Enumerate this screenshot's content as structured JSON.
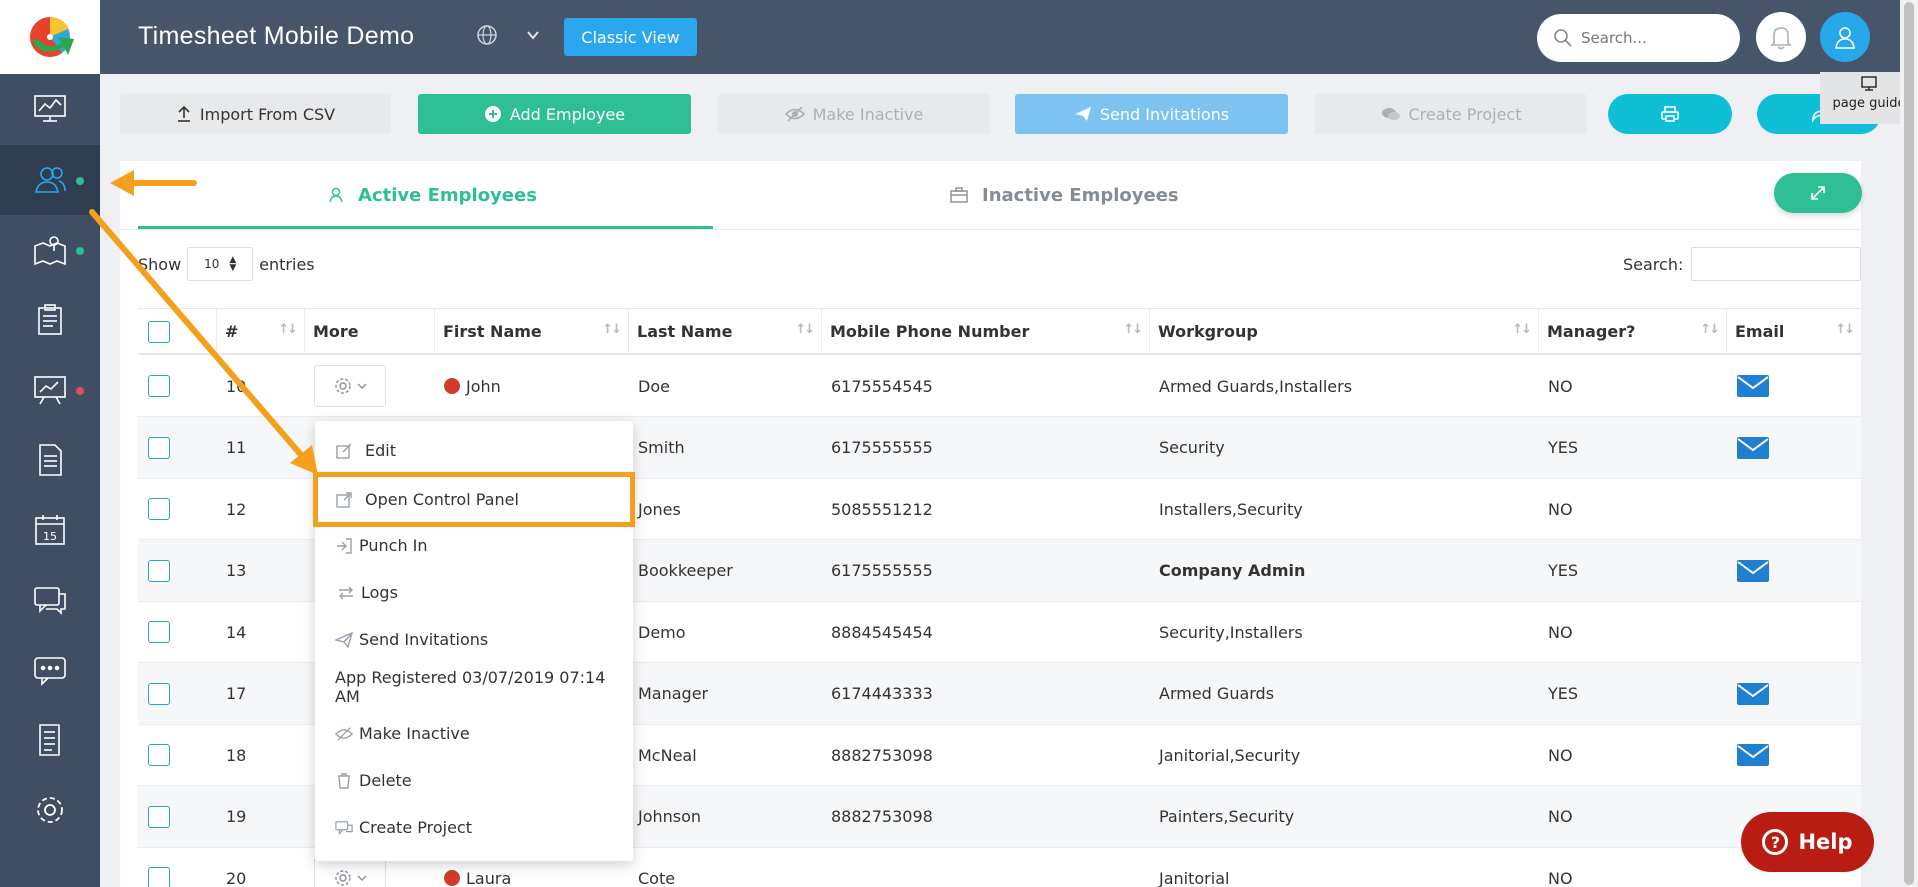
{
  "header": {
    "title": "Timesheet Mobile Demo",
    "classic_view": "Classic View",
    "search_placeholder": "Search..."
  },
  "toolbar": {
    "import_csv": "Import From CSV",
    "add_employee": "Add Employee",
    "make_inactive": "Make Inactive",
    "send_invitations": "Send Invitations",
    "create_project": "Create Project",
    "page_guide": "page guide"
  },
  "tabs": {
    "active": "Active Employees",
    "inactive": "Inactive Employees"
  },
  "table_controls": {
    "show": "Show",
    "entries_value": "10",
    "entries": "entries",
    "search_label": "Search:"
  },
  "columns": [
    "#",
    "More",
    "First Name",
    "Last Name",
    "Mobile Phone Number",
    "Workgroup",
    "Manager?",
    "Email"
  ],
  "rows": [
    {
      "num": "10",
      "first": "John",
      "last": "Doe",
      "phone": "6175554545",
      "workgroup": "Armed Guards,Installers",
      "manager": "NO",
      "email": true
    },
    {
      "num": "11",
      "first": "",
      "last": "Smith",
      "phone": "6175555555",
      "workgroup": "Security",
      "manager": "YES",
      "email": true
    },
    {
      "num": "12",
      "first": "",
      "last": "Jones",
      "phone": "5085551212",
      "workgroup": "Installers,Security",
      "manager": "NO",
      "email": false
    },
    {
      "num": "13",
      "first": "",
      "last": "Bookkeeper",
      "phone": "6175555555",
      "workgroup": "Company Admin",
      "manager": "YES",
      "email": true
    },
    {
      "num": "14",
      "first": "",
      "last": "Demo",
      "phone": "8884545454",
      "workgroup": "Security,Installers",
      "manager": "NO",
      "email": false
    },
    {
      "num": "17",
      "first": "",
      "last": "Manager",
      "phone": "6174443333",
      "workgroup": "Armed Guards",
      "manager": "YES",
      "email": true
    },
    {
      "num": "18",
      "first": "",
      "last": "McNeal",
      "phone": "8882753098",
      "workgroup": "Janitorial,Security",
      "manager": "NO",
      "email": true
    },
    {
      "num": "19",
      "first": "",
      "last": "Johnson",
      "phone": "8882753098",
      "workgroup": "Painters,Security",
      "manager": "NO",
      "email": false
    },
    {
      "num": "20",
      "first": "Laura",
      "last": "Cote",
      "phone": "",
      "workgroup": "Janitorial",
      "manager": "NO",
      "email": false
    }
  ],
  "dropdown": {
    "edit": "Edit",
    "open_control_panel": "Open Control Panel",
    "punch_in": "Punch In",
    "logs": "Logs",
    "send_invitations": "Send Invitations",
    "app_registered": "App Registered 03/07/2019 07:14 AM",
    "make_inactive": "Make Inactive",
    "delete": "Delete",
    "create_project": "Create Project"
  },
  "help": "Help",
  "colors": {
    "sidebar": "#3f4e63",
    "header": "#465569",
    "accent_green": "#2ebf95",
    "accent_blue": "#2aa7ef",
    "highlight_orange": "#f4a01c",
    "help_red": "#b91c12"
  }
}
